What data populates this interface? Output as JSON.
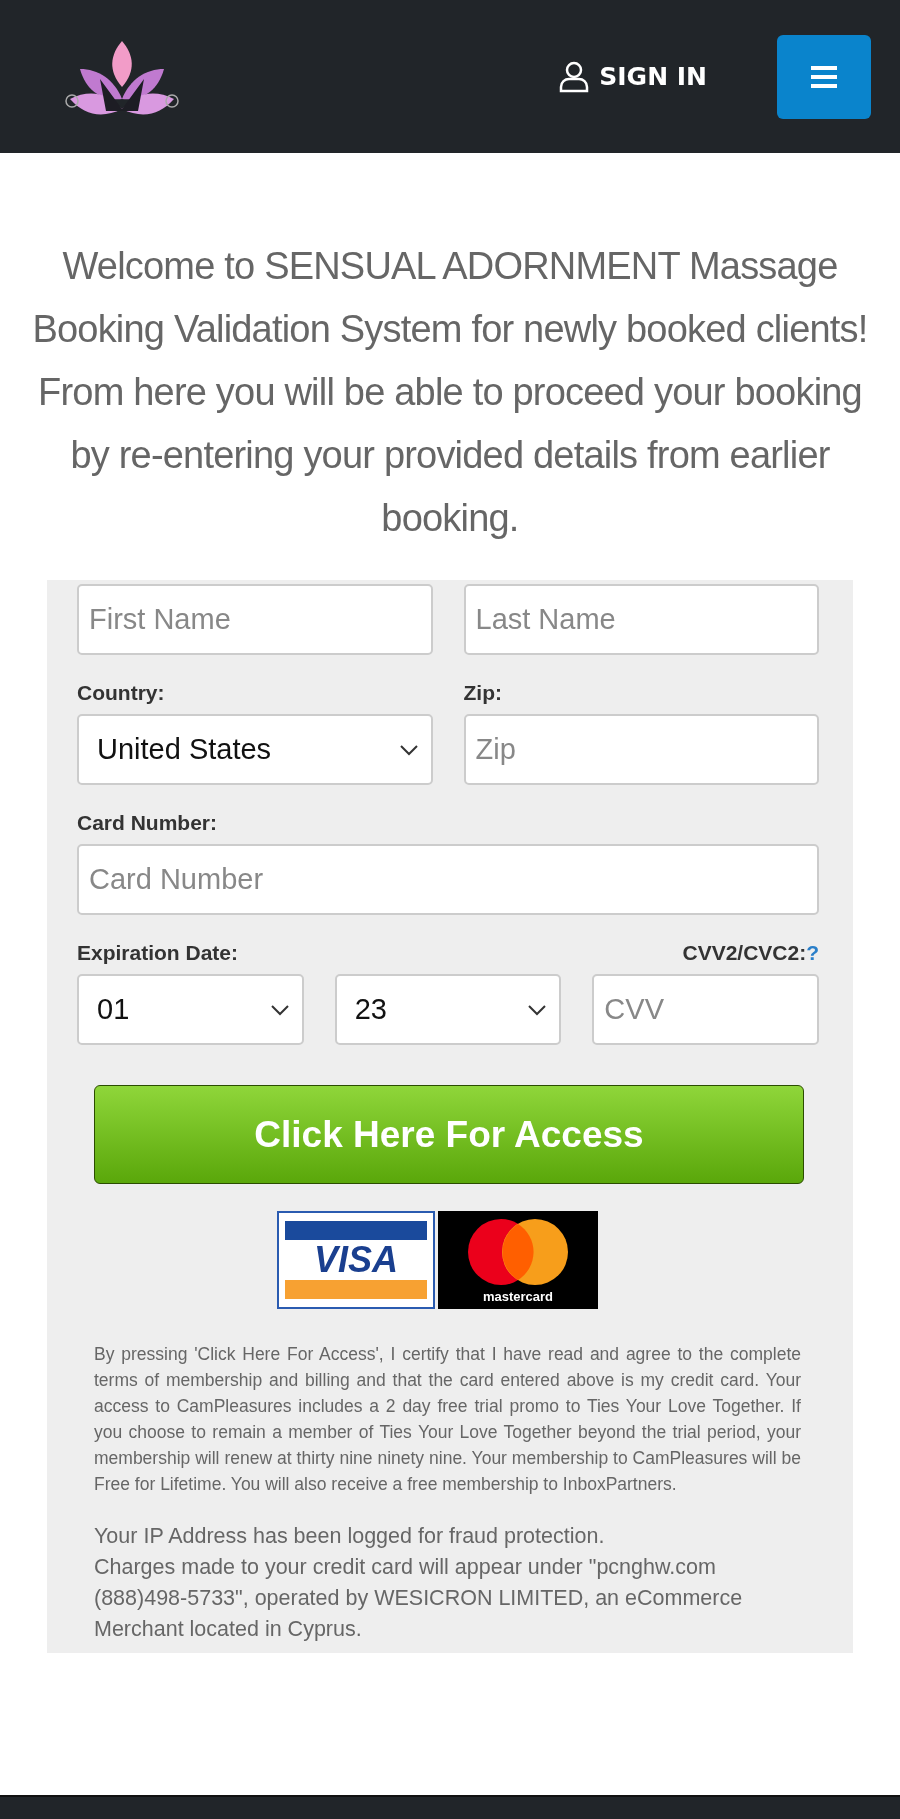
{
  "header": {
    "sign_in": "SIGN IN"
  },
  "welcome": "Welcome to SENSUAL ADORNMENT Massage Booking Validation System for newly booked clients! From here you will be able to proceed your booking by re-entering your provided details from earlier booking.",
  "form": {
    "name_fields": [
      {
        "placeholder": "First Name"
      },
      {
        "placeholder": "Last Name"
      }
    ],
    "country": {
      "label": "Country:",
      "value": "United States"
    },
    "zip": {
      "label": "Zip:",
      "placeholder": "Zip"
    },
    "card_number": {
      "label": "Card Number:",
      "placeholder": "Card Number"
    },
    "expiration": {
      "label": "Expiration Date:",
      "month": "01",
      "year": "23"
    },
    "cvv": {
      "label": "CVV2/CVC2:",
      "help": "?",
      "placeholder": "CVV"
    },
    "submit": "Click Here For Access",
    "card_logos": {
      "visa": "VISA",
      "mastercard": "mastercard"
    },
    "terms": "By pressing 'Click Here For Access', I certify that I have read and agree to the complete terms of membership and billing and that the card entered above is my credit card. Your access to CamPleasures includes a 2 day free trial promo to Ties Your Love Together. If you choose to remain a member of Ties Your Love Together beyond the trial period, your membership will renew at thirty nine ninety nine. Your membership to CamPleasures will be Free for Lifetime. You will also receive a free membership to InboxPartners.",
    "notice": [
      "Your IP Address has been logged for fraud protection.",
      "Charges made to your credit card will appear under \"pcnghw.com (888)498-5733\", operated by WESICRON LIMITED, an eCommerce Merchant located in Cyprus."
    ]
  }
}
